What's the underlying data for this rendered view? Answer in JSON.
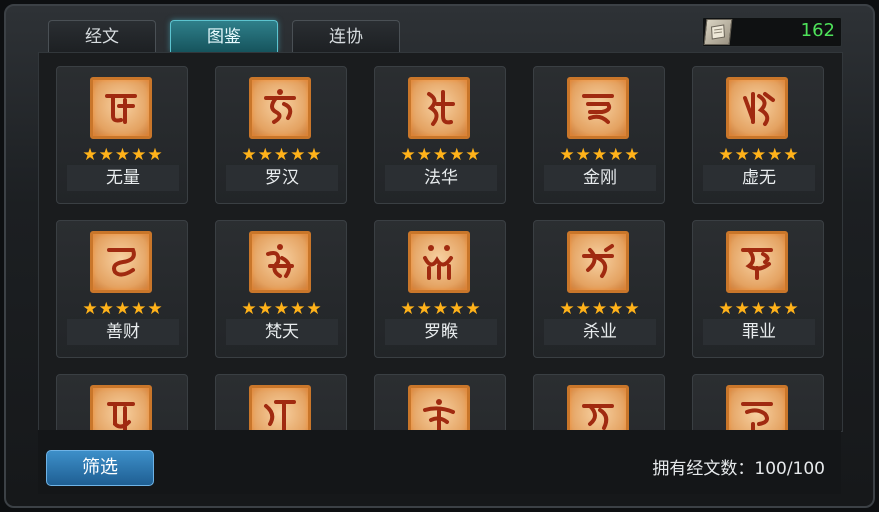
{
  "tabs": [
    {
      "label": "经文",
      "active": false
    },
    {
      "label": "图鉴",
      "active": true
    },
    {
      "label": "连协",
      "active": false
    }
  ],
  "currency": {
    "icon": "scroll-icon",
    "value": "162",
    "color": "#4ee25a"
  },
  "cards": [
    {
      "name": "无量",
      "stars": "★★★★★",
      "rating": 5
    },
    {
      "name": "罗汉",
      "stars": "★★★★★",
      "rating": 5
    },
    {
      "name": "法华",
      "stars": "★★★★★",
      "rating": 5
    },
    {
      "name": "金刚",
      "stars": "★★★★★",
      "rating": 5
    },
    {
      "name": "虚无",
      "stars": "★★★★★",
      "rating": 5
    },
    {
      "name": "善财",
      "stars": "★★★★★",
      "rating": 5
    },
    {
      "name": "梵天",
      "stars": "★★★★★",
      "rating": 5
    },
    {
      "name": "罗睺",
      "stars": "★★★★★",
      "rating": 5
    },
    {
      "name": "杀业",
      "stars": "★★★★★",
      "rating": 5
    },
    {
      "name": "罪业",
      "stars": "★★★★★",
      "rating": 5
    },
    {
      "name": "",
      "stars": "",
      "rating": null
    },
    {
      "name": "",
      "stars": "",
      "rating": null
    },
    {
      "name": "",
      "stars": "",
      "rating": null
    },
    {
      "name": "",
      "stars": "",
      "rating": null
    },
    {
      "name": "",
      "stars": "",
      "rating": null
    }
  ],
  "footer": {
    "filter_label": "筛选",
    "owned_text": "拥有经文数：100/100"
  },
  "colors": {
    "star": "#ffb21a",
    "accent_tab": "#2f7f8a",
    "filter_button": "#2f7fbf"
  }
}
